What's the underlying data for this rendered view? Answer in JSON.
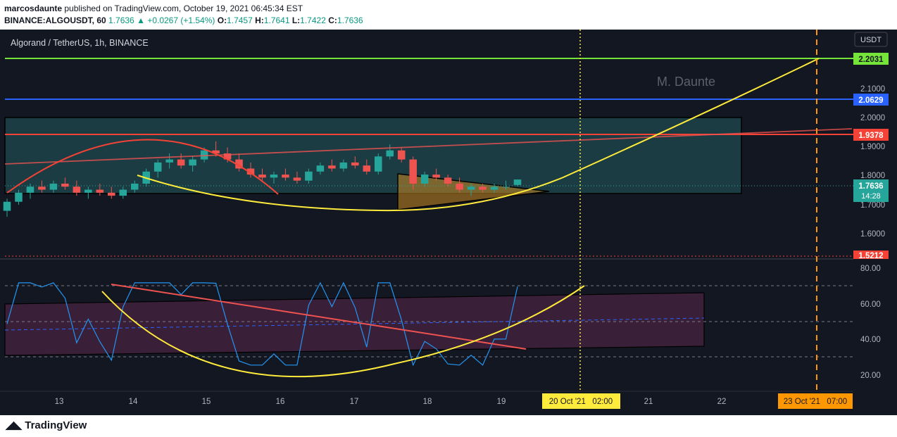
{
  "header": {
    "author": "marcosdaunte",
    "published_text": "published on TradingView.com, October 19, 2021 06:45:34 EST",
    "symbol_line": "BINANCE:ALGOUSDT, 60",
    "last_price": "1.7636",
    "change": "+0.0267 (+1.54%)",
    "open_label": "O:",
    "open": "1.7457",
    "high_label": "H:",
    "high": "1.7641",
    "low_label": "L:",
    "low": "1.7422",
    "close_label": "C:",
    "close": "1.7636"
  },
  "legend": {
    "title": "Algorand / TetherUS, 1h, BINANCE"
  },
  "watermark": "M. Daunte",
  "currency": "USDT",
  "footer": {
    "logo": "TradingView"
  },
  "colors": {
    "background": "#131722",
    "up": "#26a69a",
    "down": "#ef5350",
    "green_level": "#76e53a",
    "blue_level": "#2962ff",
    "red_level": "#f44336",
    "yellow_curve": "#ffeb3b",
    "orange_line": "#ff9800",
    "rsi_line": "#2196f3"
  },
  "chart_data": {
    "type": "candlestick",
    "symbol": "ALGOUSDT",
    "interval": "1h",
    "x_ticks": [
      "13",
      "14",
      "15",
      "16",
      "17",
      "18",
      "19",
      "20 Oct '21   02:00",
      "21",
      "22",
      "23 Oct '21   07:00"
    ],
    "price_ticks": [
      "2.1000",
      "2.0000",
      "1.9000",
      "1.8000",
      "1.7000",
      "1.6000"
    ],
    "price_range": [
      1.51,
      2.26
    ],
    "levels": [
      {
        "price": 2.2031,
        "label": "2.2031",
        "color": "#76e53a"
      },
      {
        "price": 2.0629,
        "label": "2.0629",
        "color": "#2962ff"
      },
      {
        "price": 1.9378,
        "label": "1.9378",
        "color": "#f44336"
      },
      {
        "price": 1.7636,
        "label": "1.7636",
        "sub": "14:28",
        "color": "#26a69a"
      },
      {
        "price": 1.5212,
        "label": "1.5212",
        "color": "#f44336"
      }
    ],
    "rsi": {
      "ticks": [
        "80.00",
        "60.00",
        "40.00",
        "20.00"
      ],
      "range": [
        14,
        84
      ],
      "bands": [
        70,
        50,
        30
      ]
    },
    "candles": [
      {
        "o": 1.66,
        "h": 1.7,
        "l": 1.64,
        "c": 1.69
      },
      {
        "o": 1.69,
        "h": 1.73,
        "l": 1.68,
        "c": 1.72
      },
      {
        "o": 1.72,
        "h": 1.75,
        "l": 1.7,
        "c": 1.74
      },
      {
        "o": 1.74,
        "h": 1.76,
        "l": 1.72,
        "c": 1.73
      },
      {
        "o": 1.73,
        "h": 1.76,
        "l": 1.72,
        "c": 1.75
      },
      {
        "o": 1.75,
        "h": 1.77,
        "l": 1.73,
        "c": 1.74
      },
      {
        "o": 1.74,
        "h": 1.76,
        "l": 1.71,
        "c": 1.72
      },
      {
        "o": 1.72,
        "h": 1.74,
        "l": 1.7,
        "c": 1.73
      },
      {
        "o": 1.73,
        "h": 1.75,
        "l": 1.71,
        "c": 1.72
      },
      {
        "o": 1.72,
        "h": 1.74,
        "l": 1.7,
        "c": 1.71
      },
      {
        "o": 1.71,
        "h": 1.74,
        "l": 1.7,
        "c": 1.73
      },
      {
        "o": 1.73,
        "h": 1.76,
        "l": 1.72,
        "c": 1.75
      },
      {
        "o": 1.75,
        "h": 1.8,
        "l": 1.74,
        "c": 1.79
      },
      {
        "o": 1.79,
        "h": 1.83,
        "l": 1.77,
        "c": 1.82
      },
      {
        "o": 1.82,
        "h": 1.85,
        "l": 1.8,
        "c": 1.83
      },
      {
        "o": 1.83,
        "h": 1.85,
        "l": 1.8,
        "c": 1.81
      },
      {
        "o": 1.81,
        "h": 1.84,
        "l": 1.79,
        "c": 1.83
      },
      {
        "o": 1.83,
        "h": 1.87,
        "l": 1.82,
        "c": 1.86
      },
      {
        "o": 1.86,
        "h": 1.89,
        "l": 1.84,
        "c": 1.85
      },
      {
        "o": 1.85,
        "h": 1.87,
        "l": 1.82,
        "c": 1.83
      },
      {
        "o": 1.83,
        "h": 1.85,
        "l": 1.79,
        "c": 1.8
      },
      {
        "o": 1.8,
        "h": 1.82,
        "l": 1.77,
        "c": 1.78
      },
      {
        "o": 1.78,
        "h": 1.8,
        "l": 1.76,
        "c": 1.77
      },
      {
        "o": 1.77,
        "h": 1.79,
        "l": 1.75,
        "c": 1.78
      },
      {
        "o": 1.78,
        "h": 1.8,
        "l": 1.76,
        "c": 1.77
      },
      {
        "o": 1.77,
        "h": 1.79,
        "l": 1.75,
        "c": 1.76
      },
      {
        "o": 1.76,
        "h": 1.8,
        "l": 1.75,
        "c": 1.79
      },
      {
        "o": 1.79,
        "h": 1.82,
        "l": 1.78,
        "c": 1.81
      },
      {
        "o": 1.81,
        "h": 1.83,
        "l": 1.79,
        "c": 1.8
      },
      {
        "o": 1.8,
        "h": 1.83,
        "l": 1.79,
        "c": 1.82
      },
      {
        "o": 1.82,
        "h": 1.84,
        "l": 1.8,
        "c": 1.81
      },
      {
        "o": 1.81,
        "h": 1.83,
        "l": 1.78,
        "c": 1.79
      },
      {
        "o": 1.79,
        "h": 1.85,
        "l": 1.78,
        "c": 1.84
      },
      {
        "o": 1.84,
        "h": 1.88,
        "l": 1.83,
        "c": 1.86
      },
      {
        "o": 1.86,
        "h": 1.87,
        "l": 1.82,
        "c": 1.83
      },
      {
        "o": 1.83,
        "h": 1.84,
        "l": 1.73,
        "c": 1.75
      },
      {
        "o": 1.75,
        "h": 1.79,
        "l": 1.74,
        "c": 1.78
      },
      {
        "o": 1.78,
        "h": 1.8,
        "l": 1.76,
        "c": 1.77
      },
      {
        "o": 1.77,
        "h": 1.78,
        "l": 1.74,
        "c": 1.75
      },
      {
        "o": 1.75,
        "h": 1.77,
        "l": 1.72,
        "c": 1.73
      },
      {
        "o": 1.73,
        "h": 1.75,
        "l": 1.71,
        "c": 1.74
      },
      {
        "o": 1.74,
        "h": 1.75,
        "l": 1.72,
        "c": 1.73
      },
      {
        "o": 1.73,
        "h": 1.75,
        "l": 1.72,
        "c": 1.74
      },
      {
        "o": 1.74,
        "h": 1.76,
        "l": 1.73,
        "c": 1.74
      },
      {
        "o": 1.7457,
        "h": 1.7641,
        "l": 1.7422,
        "c": 1.7636
      }
    ]
  }
}
